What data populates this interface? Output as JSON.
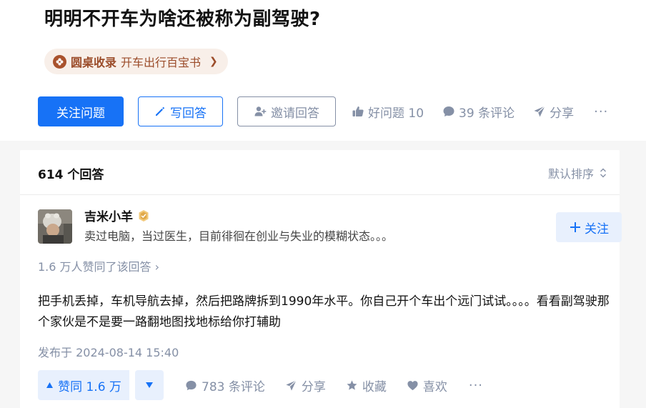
{
  "question": {
    "title": "明明不开车为啥还被称为副驾驶?"
  },
  "roundtable": {
    "brand": "圆桌收录",
    "name": "开车出行百宝书",
    "chevron": "❯"
  },
  "actions": {
    "follow_label": "关注问题",
    "answer_label": "写回答",
    "invite_label": "邀请回答",
    "good_question_label": "好问题 10",
    "comments_label": "39 条评论",
    "share_label": "分享",
    "more_label": "···"
  },
  "answers": {
    "count_label": "614 个回答",
    "sort_label": "默认排序"
  },
  "answer": {
    "author_name": "吉米小羊",
    "author_bio": "卖过电脑，当过医生，目前徘徊在创业与失业的模糊状态。。。",
    "follow_author_label": "关注",
    "upvote_summary": "1.6 万人赞同了该回答",
    "upvote_summary_chevron": "›",
    "content": "把手机丢掉，车机导航去掉，然后把路牌拆到1990年水平。你自己开个车出个远门试试。。。。看看副驾驶那个家伙是不是要一路翻地图找地标给你打辅助",
    "published": "发布于 2024-08-14 15:40",
    "vote_label": "赞同 1.6 万",
    "comments_label": "783 条评论",
    "share_label": "分享",
    "collect_label": "收藏",
    "like_label": "喜欢",
    "more_label": "···"
  },
  "colors": {
    "brand_blue": "#1772f6",
    "gray_text": "#8590a6",
    "roundtable_brown": "#9b4c2a"
  },
  "icons": [
    "roundtable-flower-icon",
    "pencil-icon",
    "add-user-icon",
    "thumbs-up-icon",
    "comment-bubble-icon",
    "paper-plane-icon",
    "sort-arrows-icon",
    "verified-badge-icon",
    "plus-icon",
    "triangle-up-icon",
    "triangle-down-icon",
    "star-icon",
    "heart-icon"
  ]
}
